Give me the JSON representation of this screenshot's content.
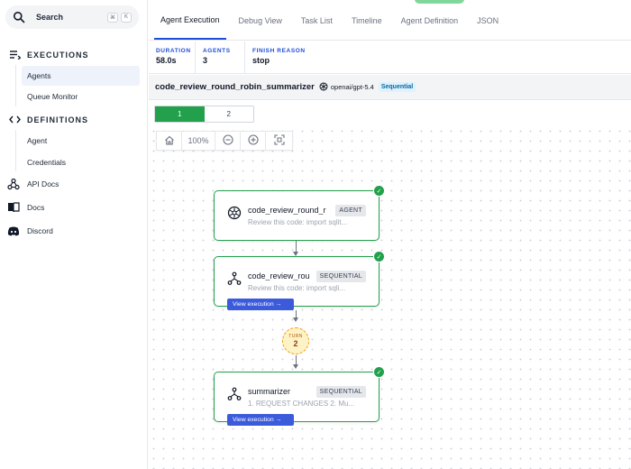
{
  "sidebar": {
    "search": {
      "label": "Search",
      "shortcut": [
        "⌘",
        "K"
      ]
    },
    "executions": {
      "title": "EXECUTIONS",
      "items": [
        "Agents",
        "Queue Monitor"
      ]
    },
    "definitions": {
      "title": "DEFINITIONS",
      "items": [
        "Agent",
        "Credentials"
      ]
    },
    "links": [
      "API Docs",
      "Docs",
      "Discord"
    ]
  },
  "tabs": [
    "Agent Execution",
    "Debug View",
    "Task List",
    "Timeline",
    "Agent Definition",
    "JSON"
  ],
  "stats": [
    {
      "label": "DURATION",
      "value": "58.0s"
    },
    {
      "label": "AGENTS",
      "value": "3"
    },
    {
      "label": "FINISH REASON",
      "value": "stop"
    }
  ],
  "titlebar": {
    "name": "code_review_round_robin_summarizer",
    "model": "openai/gpt-5.4",
    "strategy": "Sequential"
  },
  "turns": [
    "1",
    "2"
  ],
  "toolbar": {
    "zoom": "100%"
  },
  "nodes": [
    {
      "title": "code_review_round_r",
      "tag": "AGENT",
      "subtitle": "Review this code: import sqlit..."
    },
    {
      "title": "code_review_rou",
      "tag": "SEQUENTIAL",
      "subtitle": "Review this code: import sqli...",
      "action": "View execution →"
    },
    {
      "title": "summarizer",
      "tag": "SEQUENTIAL",
      "subtitle": "1. REQUEST CHANGES 2. Mu...",
      "action": "View execution →"
    }
  ],
  "turn_marker": {
    "label": "TURN",
    "value": "2"
  },
  "colors": {
    "accent": "#1d4ed8",
    "success": "#22a04b",
    "button": "#3b5bdb",
    "turn": "#f59e0b"
  }
}
